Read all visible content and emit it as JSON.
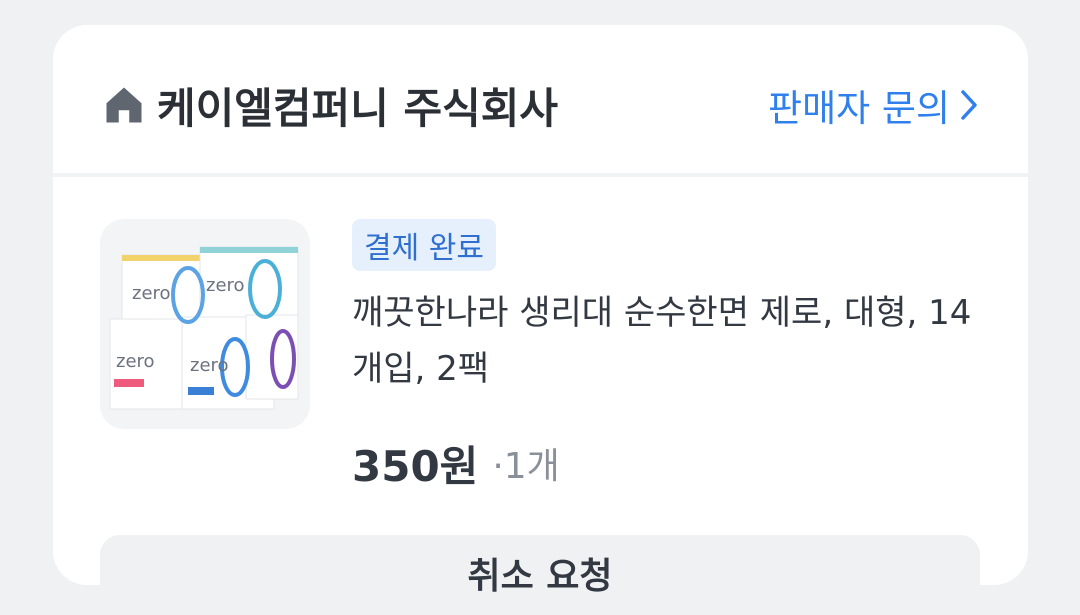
{
  "store": {
    "name": "케이엘컴퍼니 주식회사",
    "icon": "home-icon",
    "seller_inquiry": "판매자 문의"
  },
  "order": {
    "status": "결제 완료",
    "product_title": "깨끗한나라 생리대 순수한면 제로, 대형, 14개입, 2팩",
    "price": "350원",
    "quantity": "·1개",
    "thumbnail_text": "zero"
  },
  "bottom_button": {
    "label": "취소 요청"
  },
  "colors": {
    "accent": "#2f80ed",
    "badge_bg": "#e6f0fd",
    "background": "#f0f1f3"
  }
}
